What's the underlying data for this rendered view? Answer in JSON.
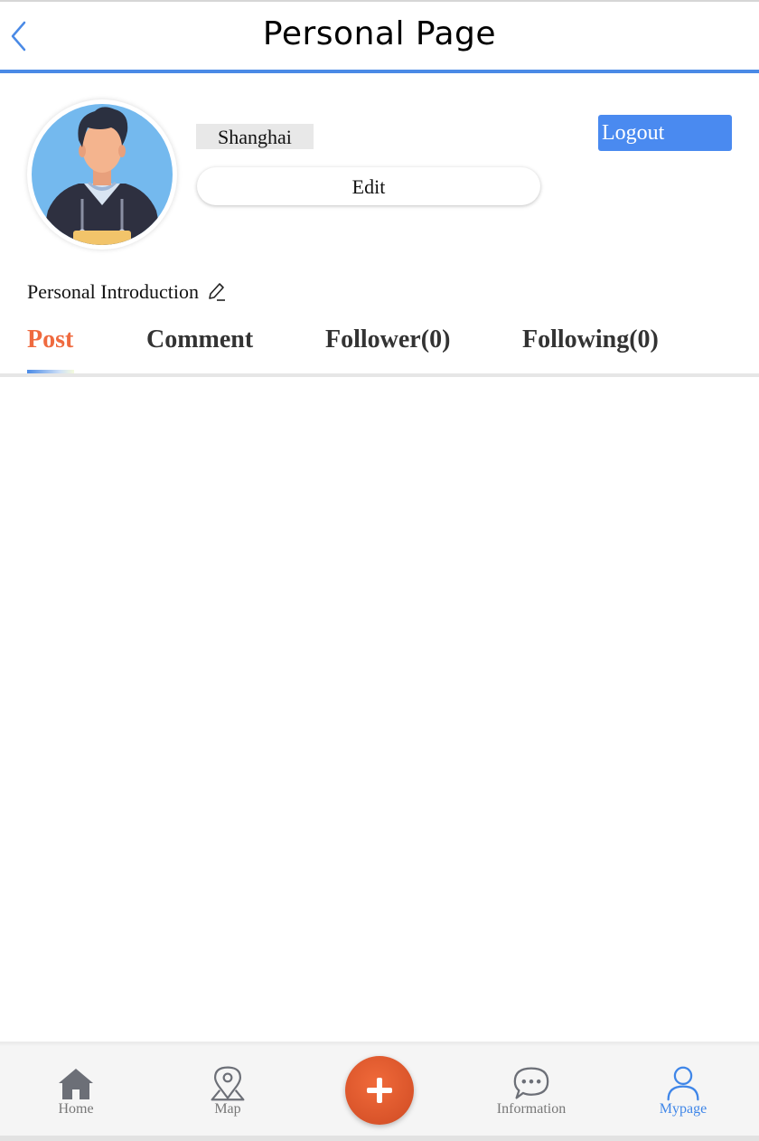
{
  "header": {
    "title": "Personal Page"
  },
  "profile": {
    "location": "Shanghai",
    "edit_label": "Edit",
    "logout_label": "Logout",
    "introduction_label": "Personal Introduction"
  },
  "tabs": [
    {
      "label": "Post",
      "active": true
    },
    {
      "label": "Comment",
      "active": false
    },
    {
      "label": "Follower(0)",
      "active": false
    },
    {
      "label": "Following(0)",
      "active": false
    }
  ],
  "bottom_nav": [
    {
      "label": "Home",
      "icon": "home-icon"
    },
    {
      "label": "Map",
      "icon": "map-pin-icon"
    },
    {
      "label": "",
      "icon": "plus-icon"
    },
    {
      "label": "Information",
      "icon": "chat-bubble-icon"
    },
    {
      "label": "Mypage",
      "icon": "user-icon",
      "active": true
    }
  ],
  "colors": {
    "accent_blue": "#4a8ae6",
    "active_tab": "#ef6a3f",
    "logout_bg": "#4a8af0",
    "add_button": "#d9542a"
  }
}
